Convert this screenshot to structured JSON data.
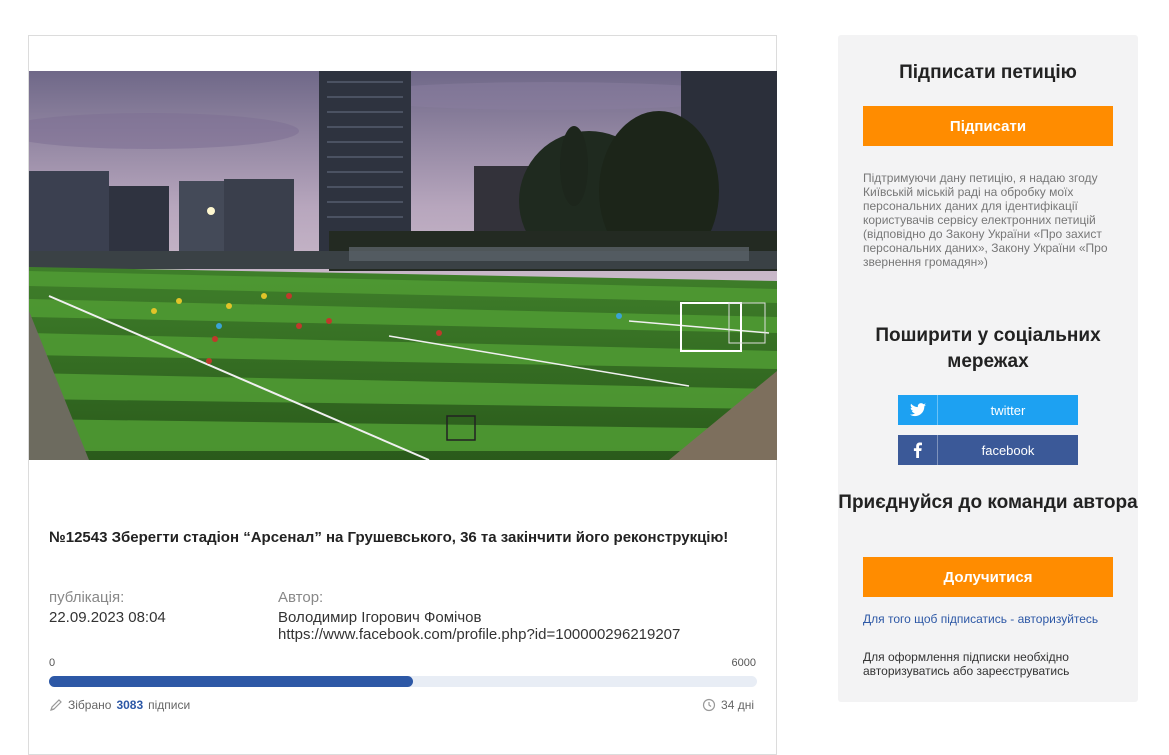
{
  "petition": {
    "title": "№12543 Зберегти стадіон “Арсенал” на Грушевського, 36 та закінчити його реконструкцію!",
    "publication_label": "публікація:",
    "publication_date": "22.09.2023 08:04",
    "author_label": "Автор:",
    "author_name": "Володимир Ігорович Фомічов",
    "author_url": "https://www.facebook.com/profile.php?id=100000296219207"
  },
  "progress": {
    "min_label": "0",
    "max_label": "6000",
    "collected": 3083,
    "goal": 6000,
    "collected_prefix": "Зібрано",
    "collected_count": "3083",
    "collected_suffix": "підписи",
    "days_left": "34 дні"
  },
  "sidebar": {
    "sign_heading": "Підписати петицію",
    "sign_button": "Підписати",
    "consent_text": "Підтримуючи дану петицію, я надаю згоду Київській міській раді на обробку моїх персональних даних для ідентифікації користувачів сервісу електронних петицій (відповідно до Закону України «Про захист персональних даних», Закону України «Про звернення громадян»)",
    "share_heading": "Поширити у соціальних мережах",
    "twitter_label": "twitter",
    "facebook_label": "facebook",
    "join_heading": "Приєднуйся до команди автора",
    "join_button": "Долучитися",
    "login_note": "Для того щоб підписатись - авторизуйтесь",
    "register_note": "Для оформлення підписки необхідно авторизуватись або зареєструватись"
  },
  "colors": {
    "accent_orange": "#ff8c00",
    "twitter": "#1da1f2",
    "facebook": "#3b5998",
    "progress_blue": "#2d58a6"
  }
}
